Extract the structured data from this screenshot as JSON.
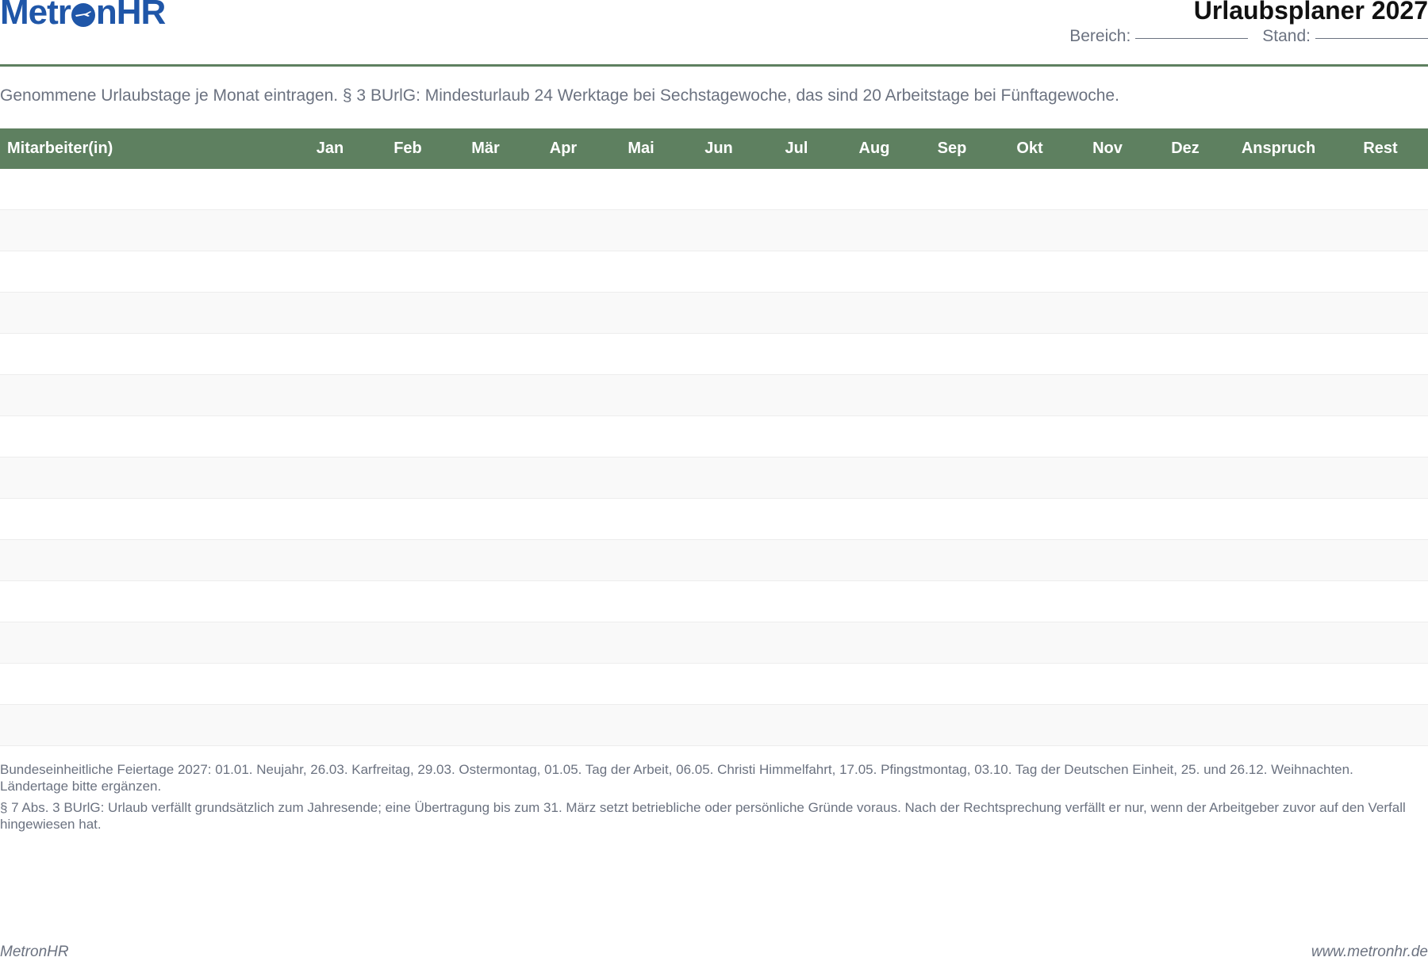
{
  "brand": {
    "logo_text_left": "Metr",
    "logo_text_right": "nHR",
    "color": "#1f56a8"
  },
  "header": {
    "title": "Urlaubsplaner 2027",
    "bereich_label": "Bereich:",
    "stand_label": "Stand:"
  },
  "intro": "Genommene Urlaubstage je Monat eintragen. § 3 BUrlG: Mindesturlaub 24 Werktage bei Sechstagewoche, das sind 20 Arbeitstage bei Fünftagewoche.",
  "table": {
    "header_color": "#5e8060",
    "columns": [
      "Mitarbeiter(in)",
      "Jan",
      "Feb",
      "Mär",
      "Apr",
      "Mai",
      "Jun",
      "Jul",
      "Aug",
      "Sep",
      "Okt",
      "Nov",
      "Dez",
      "Anspruch",
      "Rest"
    ],
    "row_count": 14
  },
  "notes": [
    "Bundeseinheitliche Feiertage 2027: 01.01. Neujahr, 26.03. Karfreitag, 29.03. Ostermontag, 01.05. Tag der Arbeit, 06.05. Christi Himmelfahrt, 17.05. Pfingstmontag, 03.10. Tag der Deutschen Einheit, 25. und 26.12. Weihnachten. Ländertage bitte ergänzen.",
    "§ 7 Abs. 3 BUrlG: Urlaub verfällt grundsätzlich zum Jahresende; eine Übertragung bis zum 31. März setzt betriebliche oder persönliche Gründe voraus. Nach der Rechtsprechung verfällt er nur, wenn der Arbeitgeber zuvor auf den Verfall hingewiesen hat."
  ],
  "footer": {
    "left": "MetronHR",
    "right": "www.metronhr.de"
  }
}
